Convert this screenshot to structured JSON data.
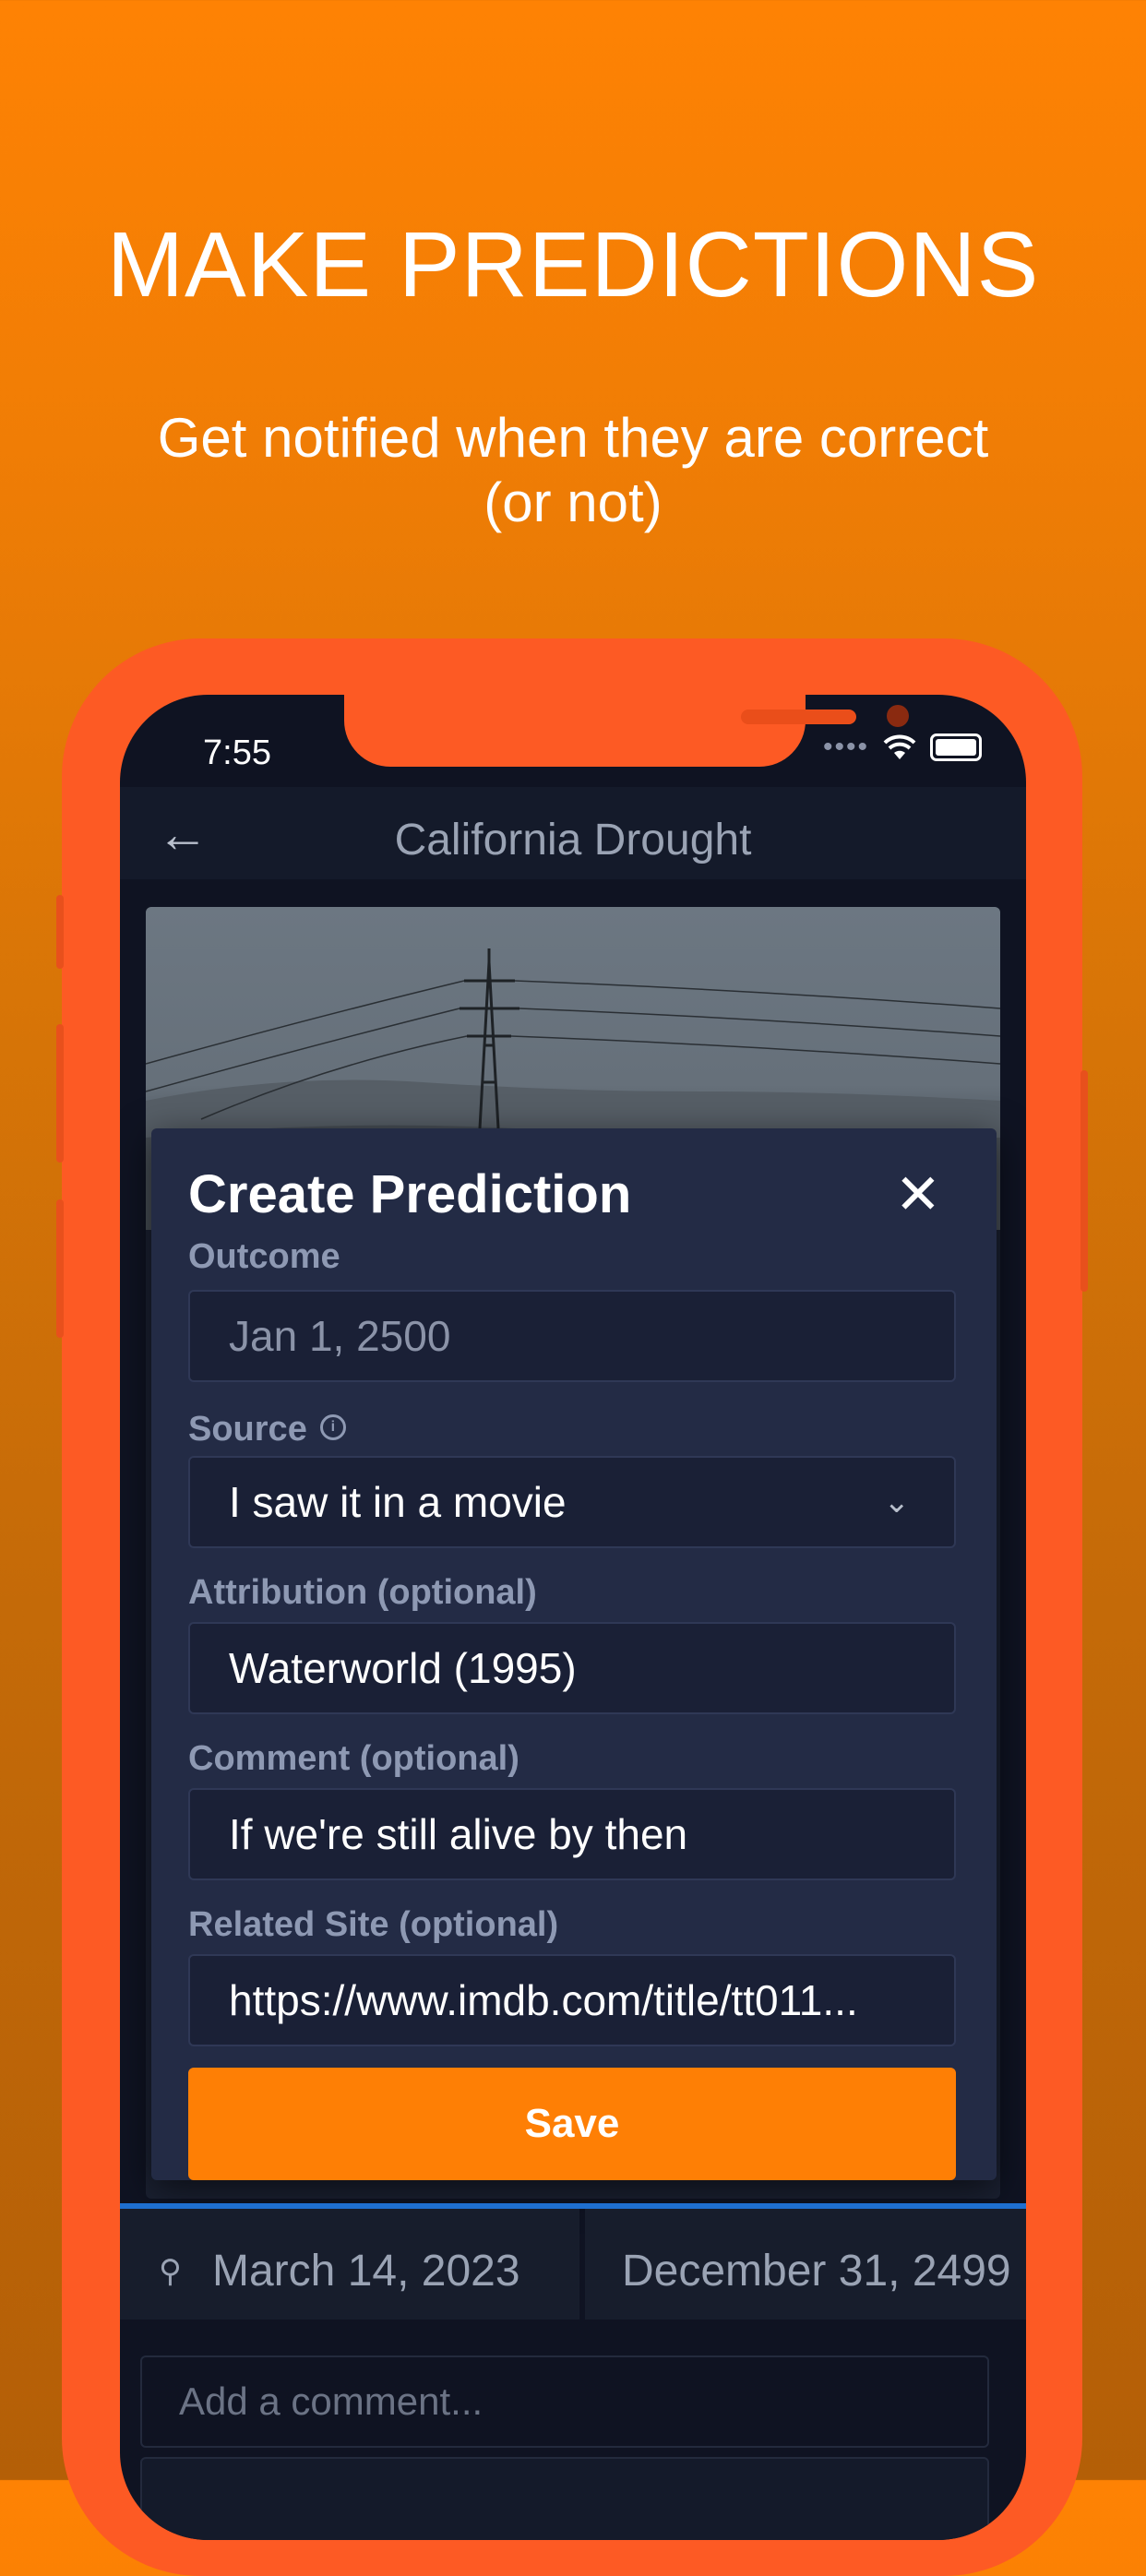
{
  "promo": {
    "headline": "MAKE PREDICTIONS",
    "subhead_line1": "Get notified when they are correct",
    "subhead_line2": "(or not)"
  },
  "status_bar": {
    "time": "7:55"
  },
  "nav": {
    "title": "California Drought",
    "back_icon": "arrow-left-icon"
  },
  "modal": {
    "title": "Create Prediction",
    "close_icon": "close-icon",
    "fields": {
      "outcome": {
        "label": "Outcome",
        "placeholder": "Jan 1, 2500"
      },
      "source": {
        "label": "Source",
        "value": "I saw it in a movie"
      },
      "attribution": {
        "label": "Attribution (optional)",
        "value": "Waterworld (1995)"
      },
      "comment": {
        "label": "Comment (optional)",
        "value": "If we're still alive by then"
      },
      "related_site": {
        "label": "Related Site (optional)",
        "value": "https://www.imdb.com/title/tt011..."
      }
    },
    "save_label": "Save"
  },
  "dates": {
    "created": "March 14, 2023",
    "outcome": "December 31, 2499"
  },
  "comment_input": {
    "placeholder": "Add a comment..."
  },
  "colors": {
    "accent": "#fe7f05",
    "phone_frame": "#fd5a24",
    "modal_bg": "#232b45"
  }
}
